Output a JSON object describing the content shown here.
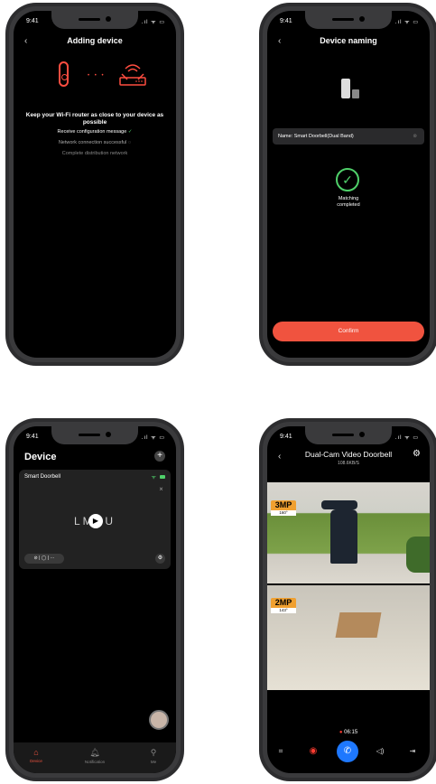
{
  "status": {
    "time": "9:41",
    "icons": ".ıl ᯤ ▭"
  },
  "screen1": {
    "back": "‹",
    "title": "Adding device",
    "dots": "• • •",
    "message": "Keep your Wi-Fi router as close to your device as possible",
    "steps": [
      {
        "label": "Receive configuration message",
        "mark": "✓"
      },
      {
        "label": "Network connection successful",
        "mark": "◌"
      },
      {
        "label": "Complete distribution network",
        "mark": ""
      }
    ]
  },
  "screen2": {
    "back": "‹",
    "title": "Device naming",
    "name_field": "Name: Smart Doorbell(Dual Band)",
    "clear": "⊗",
    "check": "✓",
    "match_line1": "Matching",
    "match_line2": "completed",
    "confirm": "Confirm"
  },
  "screen3": {
    "title": "Device",
    "plus": "+",
    "card_name": "Smart Doorbell",
    "wifi": "ᯤ",
    "mute": "⨯",
    "logo": "LMDU",
    "play": "▶",
    "controls": "⊘ | ◯ | ···",
    "gear": "⚙",
    "tabs": [
      {
        "icon": "⌂",
        "label": "Device"
      },
      {
        "icon": "🔔︎",
        "label": "Notification"
      },
      {
        "icon": "⚲",
        "label": "Me"
      }
    ]
  },
  "screen4": {
    "back": "‹",
    "title": "Dual-Cam Video Doorbell",
    "rate": "108.6KB/S",
    "gear": "⚙",
    "badge1_mp": "3MP",
    "badge1_deg": "160°",
    "badge2_mp": "2MP",
    "badge2_deg": "143°",
    "rec_dot": "●",
    "rec_time": "06:15",
    "controls": {
      "shot": "⌗",
      "record": "◉",
      "call": "✆",
      "speaker": "◁)",
      "exit": "⇥"
    }
  },
  "colors": {
    "accent": "#f0533f",
    "success": "#4fd06a",
    "call": "#1e78ff",
    "badge": "#f0a030"
  }
}
